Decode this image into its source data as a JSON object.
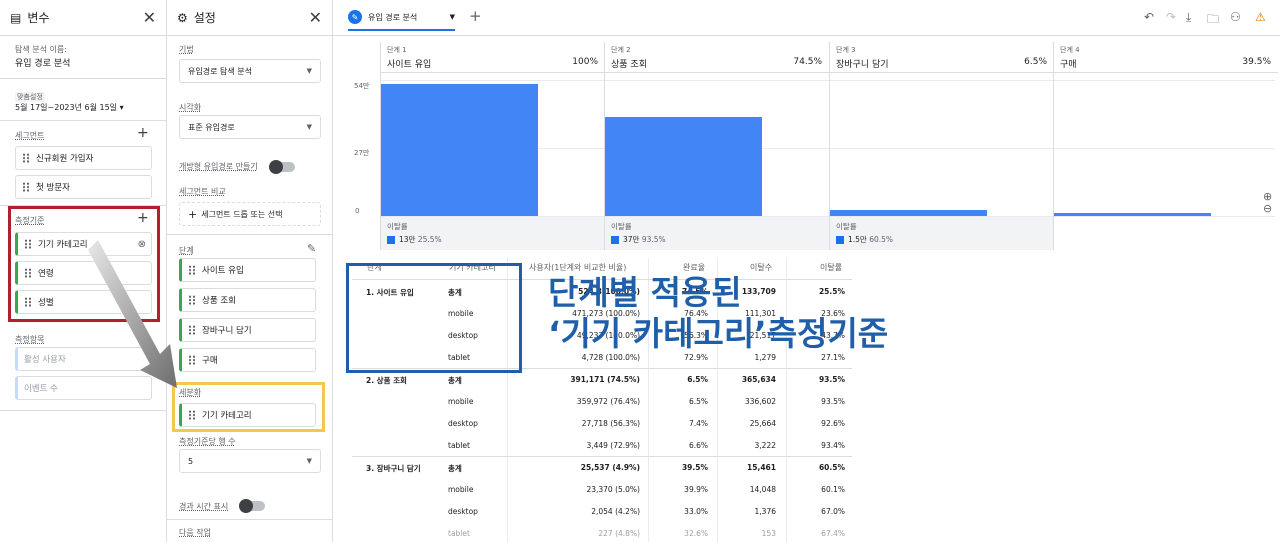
{
  "variables": {
    "title": "변수",
    "exploration_name_label": "탐색 분석 이름:",
    "exploration_name": "유입 경로 분석",
    "custom_label": "맞춤설정",
    "date_range": "5월 17일~2023년 6월 15일",
    "segments_label": "세그먼트",
    "segments": [
      "신규회원 가입자",
      "첫 방문자"
    ],
    "dimensions_label": "측정기준",
    "dimensions": [
      "기기 카테고리",
      "연령",
      "성별"
    ],
    "metrics_label": "측정항목",
    "metrics": [
      "활성 사용자",
      "이벤트 수"
    ]
  },
  "settings": {
    "title": "설정",
    "technique_label": "기법",
    "technique": "유입경로 탐색 분석",
    "viz_label": "시각화",
    "viz": "표준 유입경로",
    "open_funnel_label": "개방형 유입경로 만들기",
    "segment_compare_label": "세그먼트 비교",
    "segment_drop": "세그먼트 드롭 또는 선택",
    "steps_label": "단계",
    "steps": [
      "사이트 유입",
      "상품 조회",
      "장바구니 담기",
      "구매"
    ],
    "breakdown_label": "세분화",
    "breakdown": "기기 카테고리",
    "rows_per_dim_label": "측정기준당 행 수",
    "rows_per_dim": "5",
    "elapsed_label": "경과 시간 표시",
    "next_action_label": "다음 작업"
  },
  "tab": {
    "name": "유입 경로 분석",
    "add": "+"
  },
  "funnel": {
    "steps": [
      {
        "label": "단계 1",
        "name": "사이트 유입",
        "pct": "100%",
        "drop_label": "이탈률",
        "drop_count": "13만",
        "drop_pct": "25.5%"
      },
      {
        "label": "단계 2",
        "name": "상품 조회",
        "pct": "74.5%",
        "drop_label": "이탈률",
        "drop_count": "37만",
        "drop_pct": "93.5%"
      },
      {
        "label": "단계 3",
        "name": "장바구니 담기",
        "pct": "6.5%",
        "drop_label": "이탈률",
        "drop_count": "1.5만",
        "drop_pct": "60.5%"
      },
      {
        "label": "단계 4",
        "name": "구매",
        "pct": "39.5%"
      }
    ],
    "y_ticks": [
      "54만",
      "27만",
      "0"
    ]
  },
  "chart_data": {
    "type": "bar",
    "categories": [
      "사이트 유입",
      "상품 조회",
      "장바구니 담기",
      "구매"
    ],
    "values": [
      524000,
      391171,
      25537,
      10100
    ],
    "ylim": [
      0,
      540000
    ]
  },
  "table": {
    "headers": [
      "단계",
      "기기 카테고리",
      "사용자(1단계와 비교한 비율)",
      "완료율",
      "이탈수",
      "이탈률"
    ],
    "rows": [
      {
        "step": "1. 사이트 유입",
        "cat": "총계",
        "users": "524,8(100.0%)",
        "comp": "74.5%",
        "drop": "133,709",
        "rate": "25.5%",
        "bold": true
      },
      {
        "step": "",
        "cat": "mobile",
        "users": "471,273 (100.0%)",
        "comp": "76.4%",
        "drop": "111,301",
        "rate": "23.6%"
      },
      {
        "step": "",
        "cat": "desktop",
        "users": "49,237 (100.0%)",
        "comp": "56.3%",
        "drop": "21,517",
        "rate": "43.7%"
      },
      {
        "step": "",
        "cat": "tablet",
        "users": "4,728 (100.0%)",
        "comp": "72.9%",
        "drop": "1,279",
        "rate": "27.1%"
      },
      {
        "step": "2. 상품 조회",
        "cat": "총계",
        "users": "391,171 (74.5%)",
        "comp": "6.5%",
        "drop": "365,634",
        "rate": "93.5%",
        "bold": true
      },
      {
        "step": "",
        "cat": "mobile",
        "users": "359,972 (76.4%)",
        "comp": "6.5%",
        "drop": "336,602",
        "rate": "93.5%"
      },
      {
        "step": "",
        "cat": "desktop",
        "users": "27,718 (56.3%)",
        "comp": "7.4%",
        "drop": "25,664",
        "rate": "92.6%"
      },
      {
        "step": "",
        "cat": "tablet",
        "users": "3,449 (72.9%)",
        "comp": "6.6%",
        "drop": "3,222",
        "rate": "93.4%"
      },
      {
        "step": "3. 장바구니 담기",
        "cat": "총계",
        "users": "25,537 (4.9%)",
        "comp": "39.5%",
        "drop": "15,461",
        "rate": "60.5%",
        "bold": true
      },
      {
        "step": "",
        "cat": "mobile",
        "users": "23,370 (5.0%)",
        "comp": "39.9%",
        "drop": "14,048",
        "rate": "60.1%"
      },
      {
        "step": "",
        "cat": "desktop",
        "users": "2,054 (4.2%)",
        "comp": "33.0%",
        "drop": "1,376",
        "rate": "67.0%"
      },
      {
        "step": "",
        "cat": "tablet",
        "users": "227 (4.8%)",
        "comp": "32.6%",
        "drop": "153",
        "rate": "67.4%"
      }
    ]
  },
  "annotation": {
    "line1": "단계별 적용된",
    "line2": "‘기기 카테고리’측정기준"
  },
  "colors": {
    "bar": "#4285f4",
    "annotation": "#1f5ea8",
    "red_box": "#b21f2d",
    "yellow_box": "#f4c74f"
  }
}
